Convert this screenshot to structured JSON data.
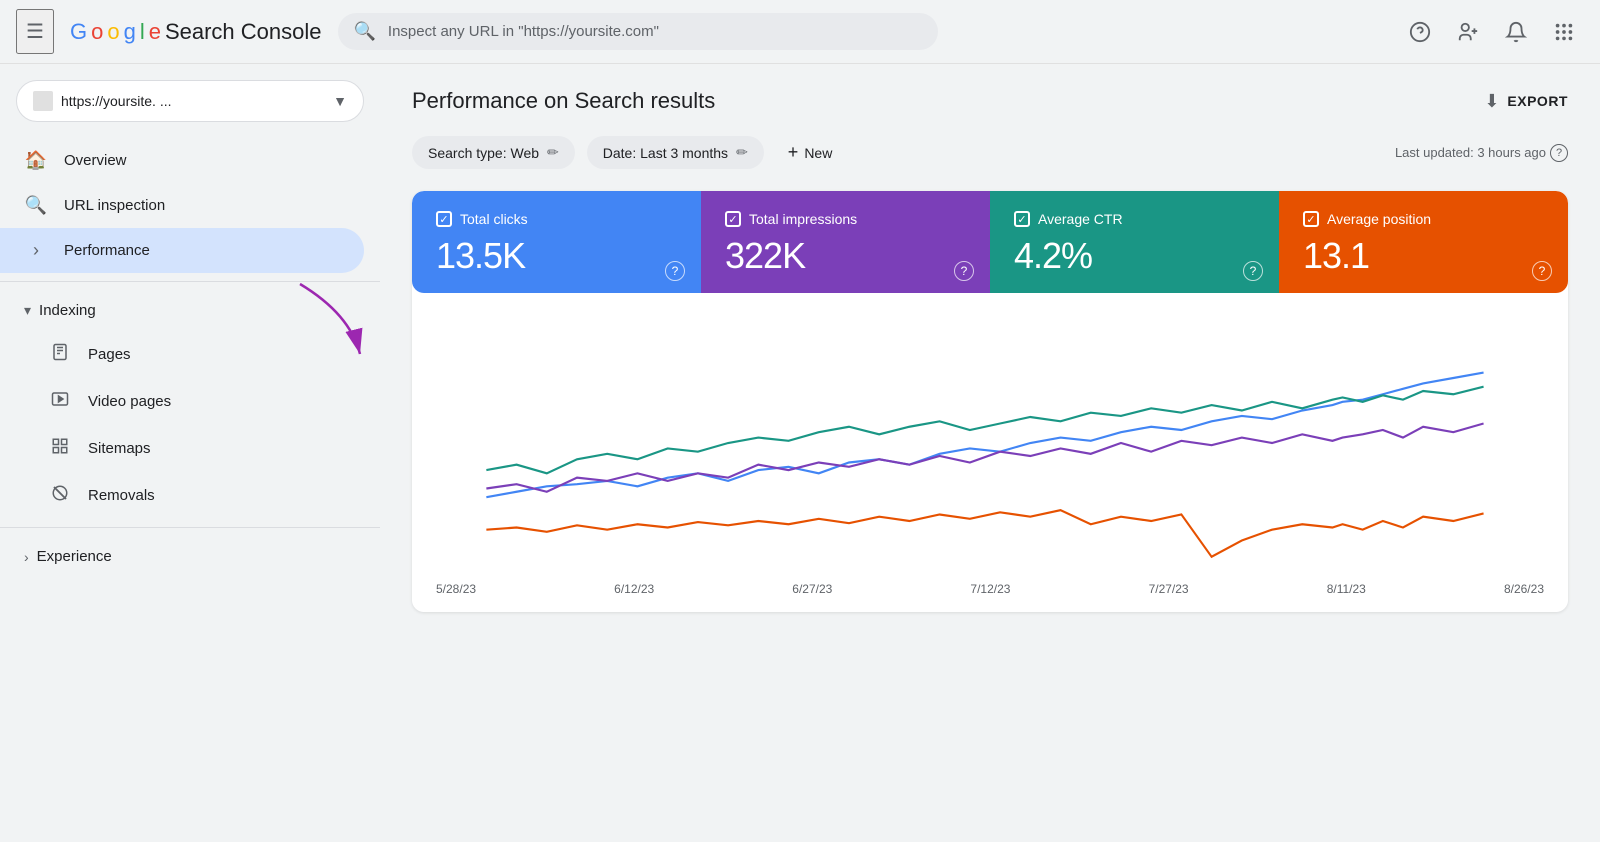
{
  "app": {
    "title": "Google Search Console"
  },
  "topbar": {
    "search_placeholder": "Inspect any URL in \"https://yoursite.com\"",
    "hamburger_label": "☰"
  },
  "logo": {
    "g": "G",
    "o": "o",
    "o2": "o",
    "g2": "g",
    "l": "l",
    "e": "e",
    "rest": " Search Console"
  },
  "sidebar": {
    "site_name": "https://yoursite. ...",
    "nav_items": [
      {
        "id": "overview",
        "label": "Overview",
        "icon": "🏠"
      },
      {
        "id": "url-inspection",
        "label": "URL inspection",
        "icon": "🔍"
      },
      {
        "id": "performance",
        "label": "Performance",
        "icon": ""
      }
    ],
    "indexing_section": {
      "label": "Indexing",
      "items": [
        {
          "id": "pages",
          "label": "Pages",
          "icon": "📄"
        },
        {
          "id": "video-pages",
          "label": "Video pages",
          "icon": "▶"
        },
        {
          "id": "sitemaps",
          "label": "Sitemaps",
          "icon": "🗺"
        },
        {
          "id": "removals",
          "label": "Removals",
          "icon": "🚫"
        }
      ]
    },
    "experience_section": {
      "label": "Experience"
    }
  },
  "main": {
    "title": "Performance on Search results",
    "export_label": "EXPORT",
    "filters": {
      "search_type": "Search type: Web",
      "date": "Date: Last 3 months",
      "new": "New",
      "last_updated": "Last updated: 3 hours ago"
    },
    "metrics": [
      {
        "id": "total-clicks",
        "label": "Total clicks",
        "value": "13.5K",
        "color": "blue"
      },
      {
        "id": "total-impressions",
        "label": "Total impressions",
        "value": "322K",
        "color": "purple"
      },
      {
        "id": "average-ctr",
        "label": "Average CTR",
        "value": "4.2%",
        "color": "teal"
      },
      {
        "id": "average-position",
        "label": "Average position",
        "value": "13.1",
        "color": "orange"
      }
    ],
    "chart": {
      "x_labels": [
        "5/28/23",
        "6/12/23",
        "6/27/23",
        "7/12/23",
        "7/27/23",
        "8/11/23",
        "8/26/23"
      ]
    }
  }
}
